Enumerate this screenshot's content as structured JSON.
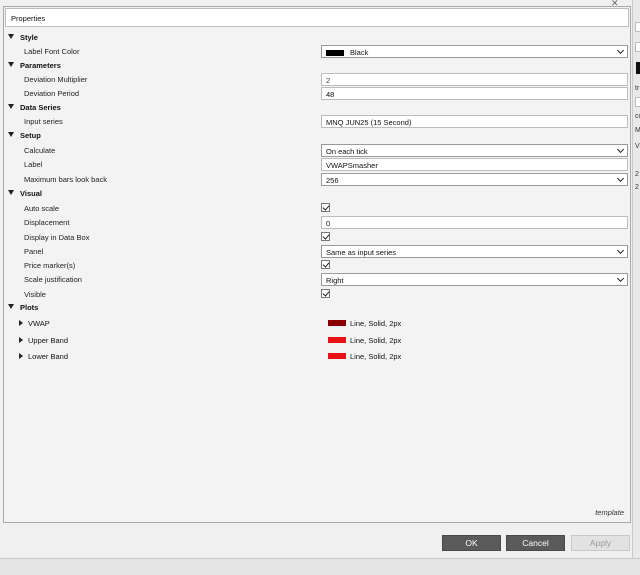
{
  "window": {
    "title": "Properties",
    "close_glyph": "✕"
  },
  "categories": {
    "style": "Style",
    "parameters": "Parameters",
    "data_series": "Data Series",
    "setup": "Setup",
    "visual": "Visual",
    "plots": "Plots"
  },
  "style": {
    "label_font_color": {
      "label": "Label Font Color",
      "value": "Black",
      "swatch": "#000000"
    }
  },
  "parameters": {
    "deviation_multiplier": {
      "label": "Deviation Multiplier",
      "value": "2"
    },
    "deviation_period": {
      "label": "Deviation Period",
      "value": "48"
    }
  },
  "data_series": {
    "input_series": {
      "label": "Input series",
      "value": "MNQ JUN25 (15 Second)"
    }
  },
  "setup": {
    "calculate": {
      "label": "Calculate",
      "value": "On each tick"
    },
    "label": {
      "label": "Label",
      "value": "VWAPSmasher"
    },
    "max_bars": {
      "label": "Maximum bars look back",
      "value": "256"
    }
  },
  "visual": {
    "auto_scale": {
      "label": "Auto scale",
      "checked": true
    },
    "displacement": {
      "label": "Displacement",
      "value": "0"
    },
    "display_in_data_box": {
      "label": "Display in Data Box",
      "checked": true
    },
    "panel": {
      "label": "Panel",
      "value": "Same as input series"
    },
    "price_marker": {
      "label": "Price marker(s)",
      "checked": true
    },
    "scale_justification": {
      "label": "Scale justification",
      "value": "Right"
    },
    "visible": {
      "label": "Visible",
      "checked": true
    }
  },
  "plots": [
    {
      "name": "VWAP",
      "desc": "Line, Solid, 2px",
      "color": "#8b0000"
    },
    {
      "name": "Upper Band",
      "desc": "Line, Solid, 2px",
      "color": "#e81010"
    },
    {
      "name": "Lower Band",
      "desc": "Line, Solid, 2px",
      "color": "#e81010"
    }
  ],
  "template_label": "template",
  "buttons": {
    "ok": "OK",
    "cancel": "Cancel",
    "apply": "Apply"
  },
  "background_fragments": [
    "tr",
    "co",
    "M",
    "V",
    "2",
    "2"
  ]
}
